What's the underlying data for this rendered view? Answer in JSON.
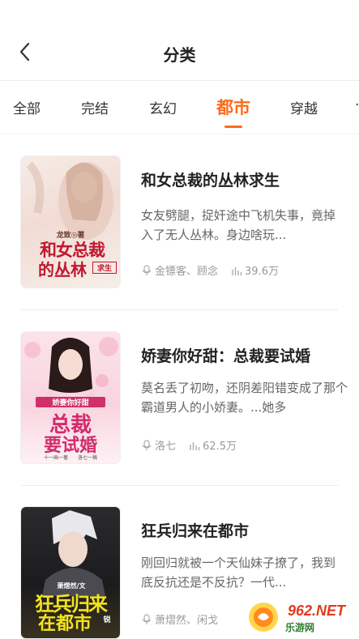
{
  "header": {
    "title": "分类"
  },
  "tabs": [
    {
      "label": "全部",
      "active": false
    },
    {
      "label": "完结",
      "active": false
    },
    {
      "label": "玄幻",
      "active": false
    },
    {
      "label": "都市",
      "active": true
    },
    {
      "label": "穿越",
      "active": false
    }
  ],
  "accent_color": "#ff6a1a",
  "books": [
    {
      "title": "和女总裁的丛林求生",
      "description": "女友劈腿，捉奸途中飞机失事，竟掉入了无人丛林。身边啥玩...",
      "authors": "金镖客、顾念",
      "popularity": "39.6万",
      "cover_text": {
        "author_line": "龙致◎著",
        "title_line1": "和女总裁",
        "title_line2": "的丛林",
        "tag": "求生"
      }
    },
    {
      "title": "娇妻你好甜：总裁要试婚",
      "description": "莫名丢了初吻，还阴差阳错变成了那个霸道男人的小娇妻。...她多",
      "authors": "洛七",
      "popularity": "62.5万",
      "cover_text": {
        "tag": "娇妻你好甜",
        "title_line1": "总裁",
        "title_line2": "要试婚",
        "author_line": "十一画一著　　洛七一稿"
      }
    },
    {
      "title": "狂兵归来在都市",
      "description": "刚回归就被一个天仙妹子撩了，我到底反抗还是不反抗？一代...",
      "authors": "萧熠然、闲戈",
      "popularity": "",
      "cover_text": {
        "author_line": "萧熠然/文",
        "title_line1": "狂兵归来",
        "title_line2": "在都市",
        "tag": "锐"
      }
    }
  ],
  "watermark": {
    "brand": "962.NET",
    "sub": "乐游网"
  }
}
